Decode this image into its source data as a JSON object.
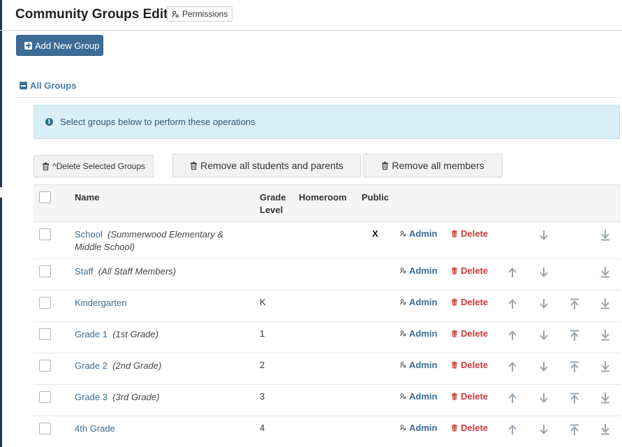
{
  "header": {
    "title": "Community Groups Edit",
    "permissions_label": "Permissions"
  },
  "toolbar": {
    "add_group_label": "Add New Group"
  },
  "section": {
    "title": "All Groups"
  },
  "info": {
    "message": "Select groups below to perform these operations"
  },
  "operations": {
    "delete_selected": "^Delete Selected Groups",
    "remove_students_parents": "Remove all students and parents",
    "remove_all_members": "Remove all members"
  },
  "table": {
    "columns": {
      "name": "Name",
      "grade_level_1": "Grade",
      "grade_level_2": "Level",
      "homeroom": "Homeroom",
      "public": "Public"
    },
    "admin_label": "Admin",
    "delete_label": "Delete",
    "rows": [
      {
        "name": "School",
        "desc": "(Summerwood Elementary & Middle School)",
        "grade": "",
        "public": "X",
        "up": false,
        "down": true,
        "top": false,
        "bottom": true
      },
      {
        "name": "Staff",
        "desc": "(All Staff Members)",
        "grade": "",
        "public": "",
        "up": true,
        "down": true,
        "top": false,
        "bottom": true
      },
      {
        "name": "Kindergarten",
        "desc": "",
        "grade": "K",
        "public": "",
        "up": true,
        "down": true,
        "top": true,
        "bottom": true
      },
      {
        "name": "Grade 1",
        "desc": "(1st Grade)",
        "grade": "1",
        "public": "",
        "up": true,
        "down": true,
        "top": true,
        "bottom": true
      },
      {
        "name": "Grade 2",
        "desc": "(2nd Grade)",
        "grade": "2",
        "public": "",
        "up": true,
        "down": true,
        "top": true,
        "bottom": true
      },
      {
        "name": "Grade 3",
        "desc": "(3rd Grade)",
        "grade": "3",
        "public": "",
        "up": true,
        "down": true,
        "top": true,
        "bottom": true
      },
      {
        "name": "4th Grade",
        "desc": "",
        "grade": "4",
        "public": "",
        "up": true,
        "down": true,
        "top": true,
        "bottom": true
      }
    ]
  },
  "colors": {
    "primary": "#3d6d96",
    "link": "#3d6d96",
    "danger": "#cf3a3a",
    "info_bg": "#d9eef6",
    "arrow": "#9aa5ad"
  }
}
